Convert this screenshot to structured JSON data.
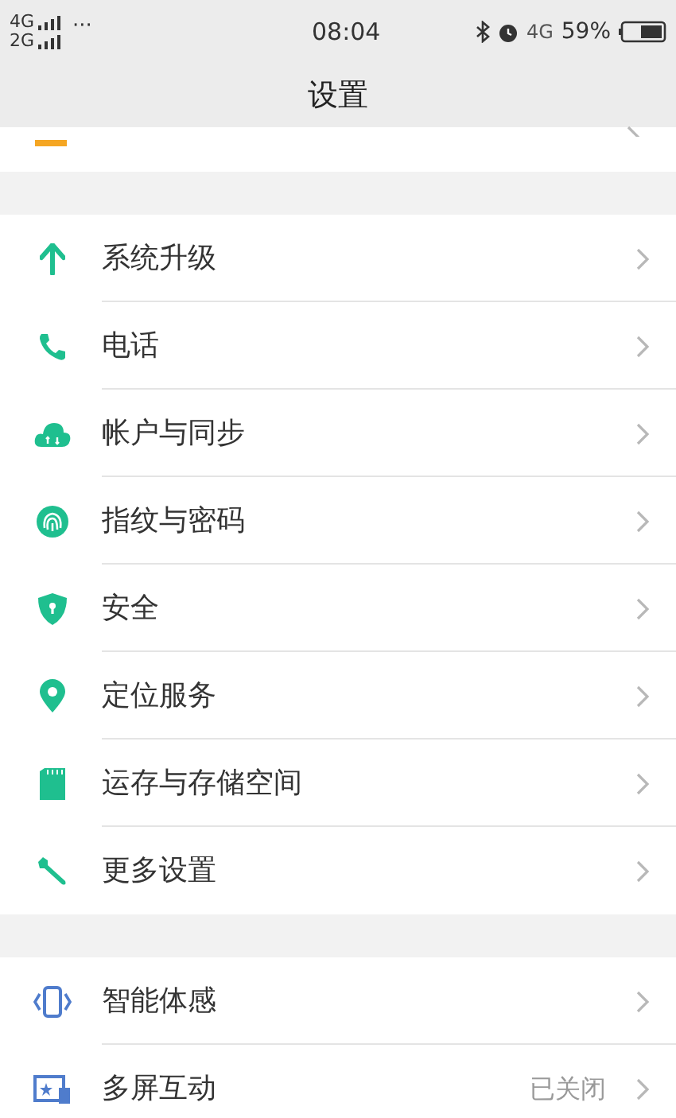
{
  "status_bar": {
    "network_1": "4G",
    "network_2": "2G",
    "more": "···",
    "time": "08:04",
    "network_3": "4G",
    "battery": "59%"
  },
  "title": "设置",
  "groups": [
    {
      "items": [
        {
          "label": "系统升级"
        },
        {
          "label": "电话"
        },
        {
          "label": "帐户与同步"
        },
        {
          "label": "指纹与密码"
        },
        {
          "label": "安全"
        },
        {
          "label": "定位服务"
        },
        {
          "label": "运存与存储空间"
        },
        {
          "label": "更多设置"
        }
      ]
    },
    {
      "items": [
        {
          "label": "智能体感"
        },
        {
          "label": "多屏互动",
          "value": "已关闭"
        }
      ]
    }
  ]
}
